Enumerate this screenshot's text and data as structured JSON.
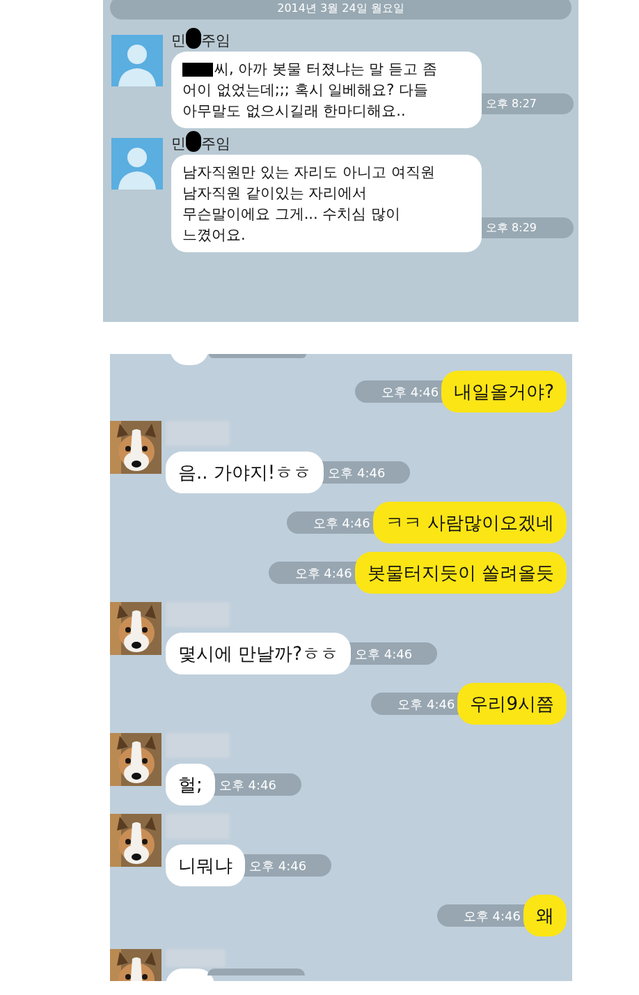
{
  "work_chat": {
    "date_divider": "2014년 3월 24일 월요일",
    "messages": [
      {
        "name_before": "민",
        "name_after": "주임",
        "redacted_prefix": true,
        "text": "씨, 아까 봇물 터졌냐는 말 듣고 좀\n어이 없었는데;;; 혹시 일베해요? 다들\n아무말도 없으시길래 한마디해요..",
        "time": "오후 8:27"
      },
      {
        "name_before": "민",
        "name_after": "주임",
        "redacted_prefix": false,
        "text": "남자직원만 있는 자리도 아니고 여직원\n남자직원 같이있는 자리에서\n무슨말이에요 그게... 수치심 많이\n느꼈어요.",
        "time": "오후 8:29"
      }
    ]
  },
  "friend_chat": {
    "messages": [
      {
        "kind": "partial"
      },
      {
        "kind": "sent",
        "text": "내일올거야?",
        "time": "오후 4:46"
      },
      {
        "kind": "received",
        "text": "음.. 가야지!ㅎㅎ",
        "time": "오후 4:46"
      },
      {
        "kind": "sent",
        "text": "ㅋㅋ 사람많이오겠네",
        "time": "오후 4:46"
      },
      {
        "kind": "sent",
        "text": "봇물터지듯이 쏠려올듯",
        "time": "오후 4:46"
      },
      {
        "kind": "received",
        "text": "몇시에 만날까?ㅎㅎ",
        "time": "오후 4:46"
      },
      {
        "kind": "sent",
        "text": "우리9시쯤",
        "time": "오후 4:46"
      },
      {
        "kind": "received",
        "text": "헐;",
        "time": "오후 4:46"
      },
      {
        "kind": "received",
        "text": "니뭐냐",
        "time": "오후 4:46"
      },
      {
        "kind": "sent",
        "text": "왜",
        "time": "오후 4:46"
      },
      {
        "kind": "partial"
      }
    ]
  }
}
